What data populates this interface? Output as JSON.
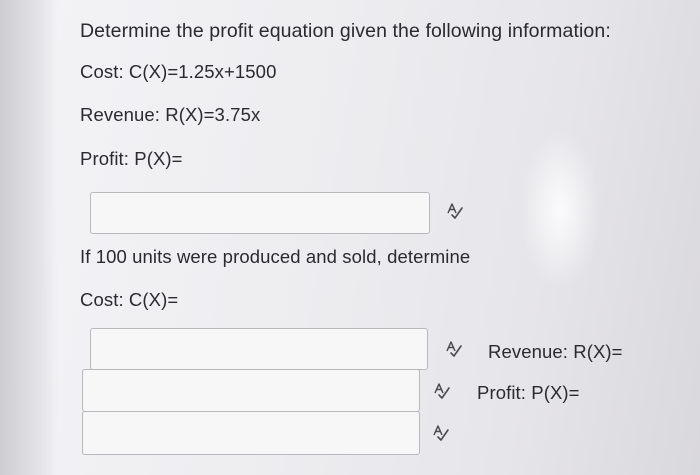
{
  "question": {
    "title": "Determine the profit equation given the following information:",
    "cost_equation": "Cost: C(X)=1.25x+1500",
    "revenue_equation": "Revenue: R(X)=3.75x",
    "profit_label": "Profit: P(X)=",
    "if_text": "If 100 units were produced and sold, determine",
    "cost_label": "Cost: C(X)=",
    "revenue_label": "Revenue: R(X)=",
    "profit_label_2": "Profit: P(X)="
  },
  "inputs": [
    {
      "value": ""
    },
    {
      "value": ""
    },
    {
      "value": ""
    },
    {
      "value": ""
    }
  ],
  "icons": {
    "spellcheck": "spellcheck-icon"
  }
}
